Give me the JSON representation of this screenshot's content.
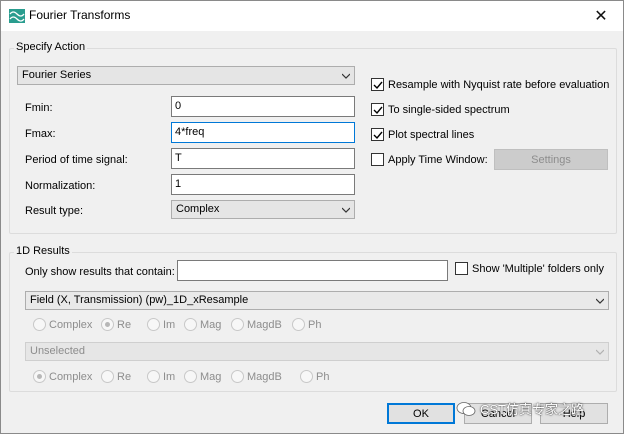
{
  "window": {
    "title": "Fourier Transforms",
    "close_glyph": "✕"
  },
  "specify_action": {
    "group_label": "Specify Action",
    "action_select": "Fourier Series",
    "fields": [
      {
        "label": "Fmin:",
        "value": "0"
      },
      {
        "label": "Fmax:",
        "value": "4*freq"
      },
      {
        "label": "Period of time signal:",
        "value": "T"
      },
      {
        "label": "Normalization:",
        "value": "1"
      }
    ],
    "result_type_label": "Result type:",
    "result_type_value": "Complex",
    "options": [
      {
        "label": "Resample with Nyquist rate before evaluation",
        "checked": true
      },
      {
        "label": "To single-sided spectrum",
        "checked": true
      },
      {
        "label": "Plot spectral lines",
        "checked": true
      },
      {
        "label": "Apply Time Window:",
        "checked": false
      }
    ],
    "settings_button": "Settings"
  },
  "results_1d": {
    "group_label": "1D Results",
    "filter_label": "Only show results that contain:",
    "filter_value": "",
    "show_multiple_label": "Show 'Multiple' folders only",
    "first_select": "Field (X, Transmission) (pw)_1D_xResample",
    "first_radios": [
      {
        "label": "Complex",
        "selected": false
      },
      {
        "label": "Re",
        "selected": true
      },
      {
        "label": "Im",
        "selected": false
      },
      {
        "label": "Mag",
        "selected": false
      },
      {
        "label": "MagdB",
        "selected": false
      },
      {
        "label": "Ph",
        "selected": false
      }
    ],
    "second_select": "Unselected",
    "second_radios": [
      {
        "label": "Complex",
        "selected": true
      },
      {
        "label": "Re",
        "selected": false
      },
      {
        "label": "Im",
        "selected": false
      },
      {
        "label": "Mag",
        "selected": false
      },
      {
        "label": "MagdB",
        "selected": false
      },
      {
        "label": "Ph",
        "selected": false
      }
    ]
  },
  "buttons": {
    "ok": "OK",
    "cancel": "Cancel",
    "help": "Help"
  },
  "watermark": "CST仿真专家之路",
  "colors": {
    "focus": "#0078d7",
    "icon": "#2a9d8f"
  }
}
